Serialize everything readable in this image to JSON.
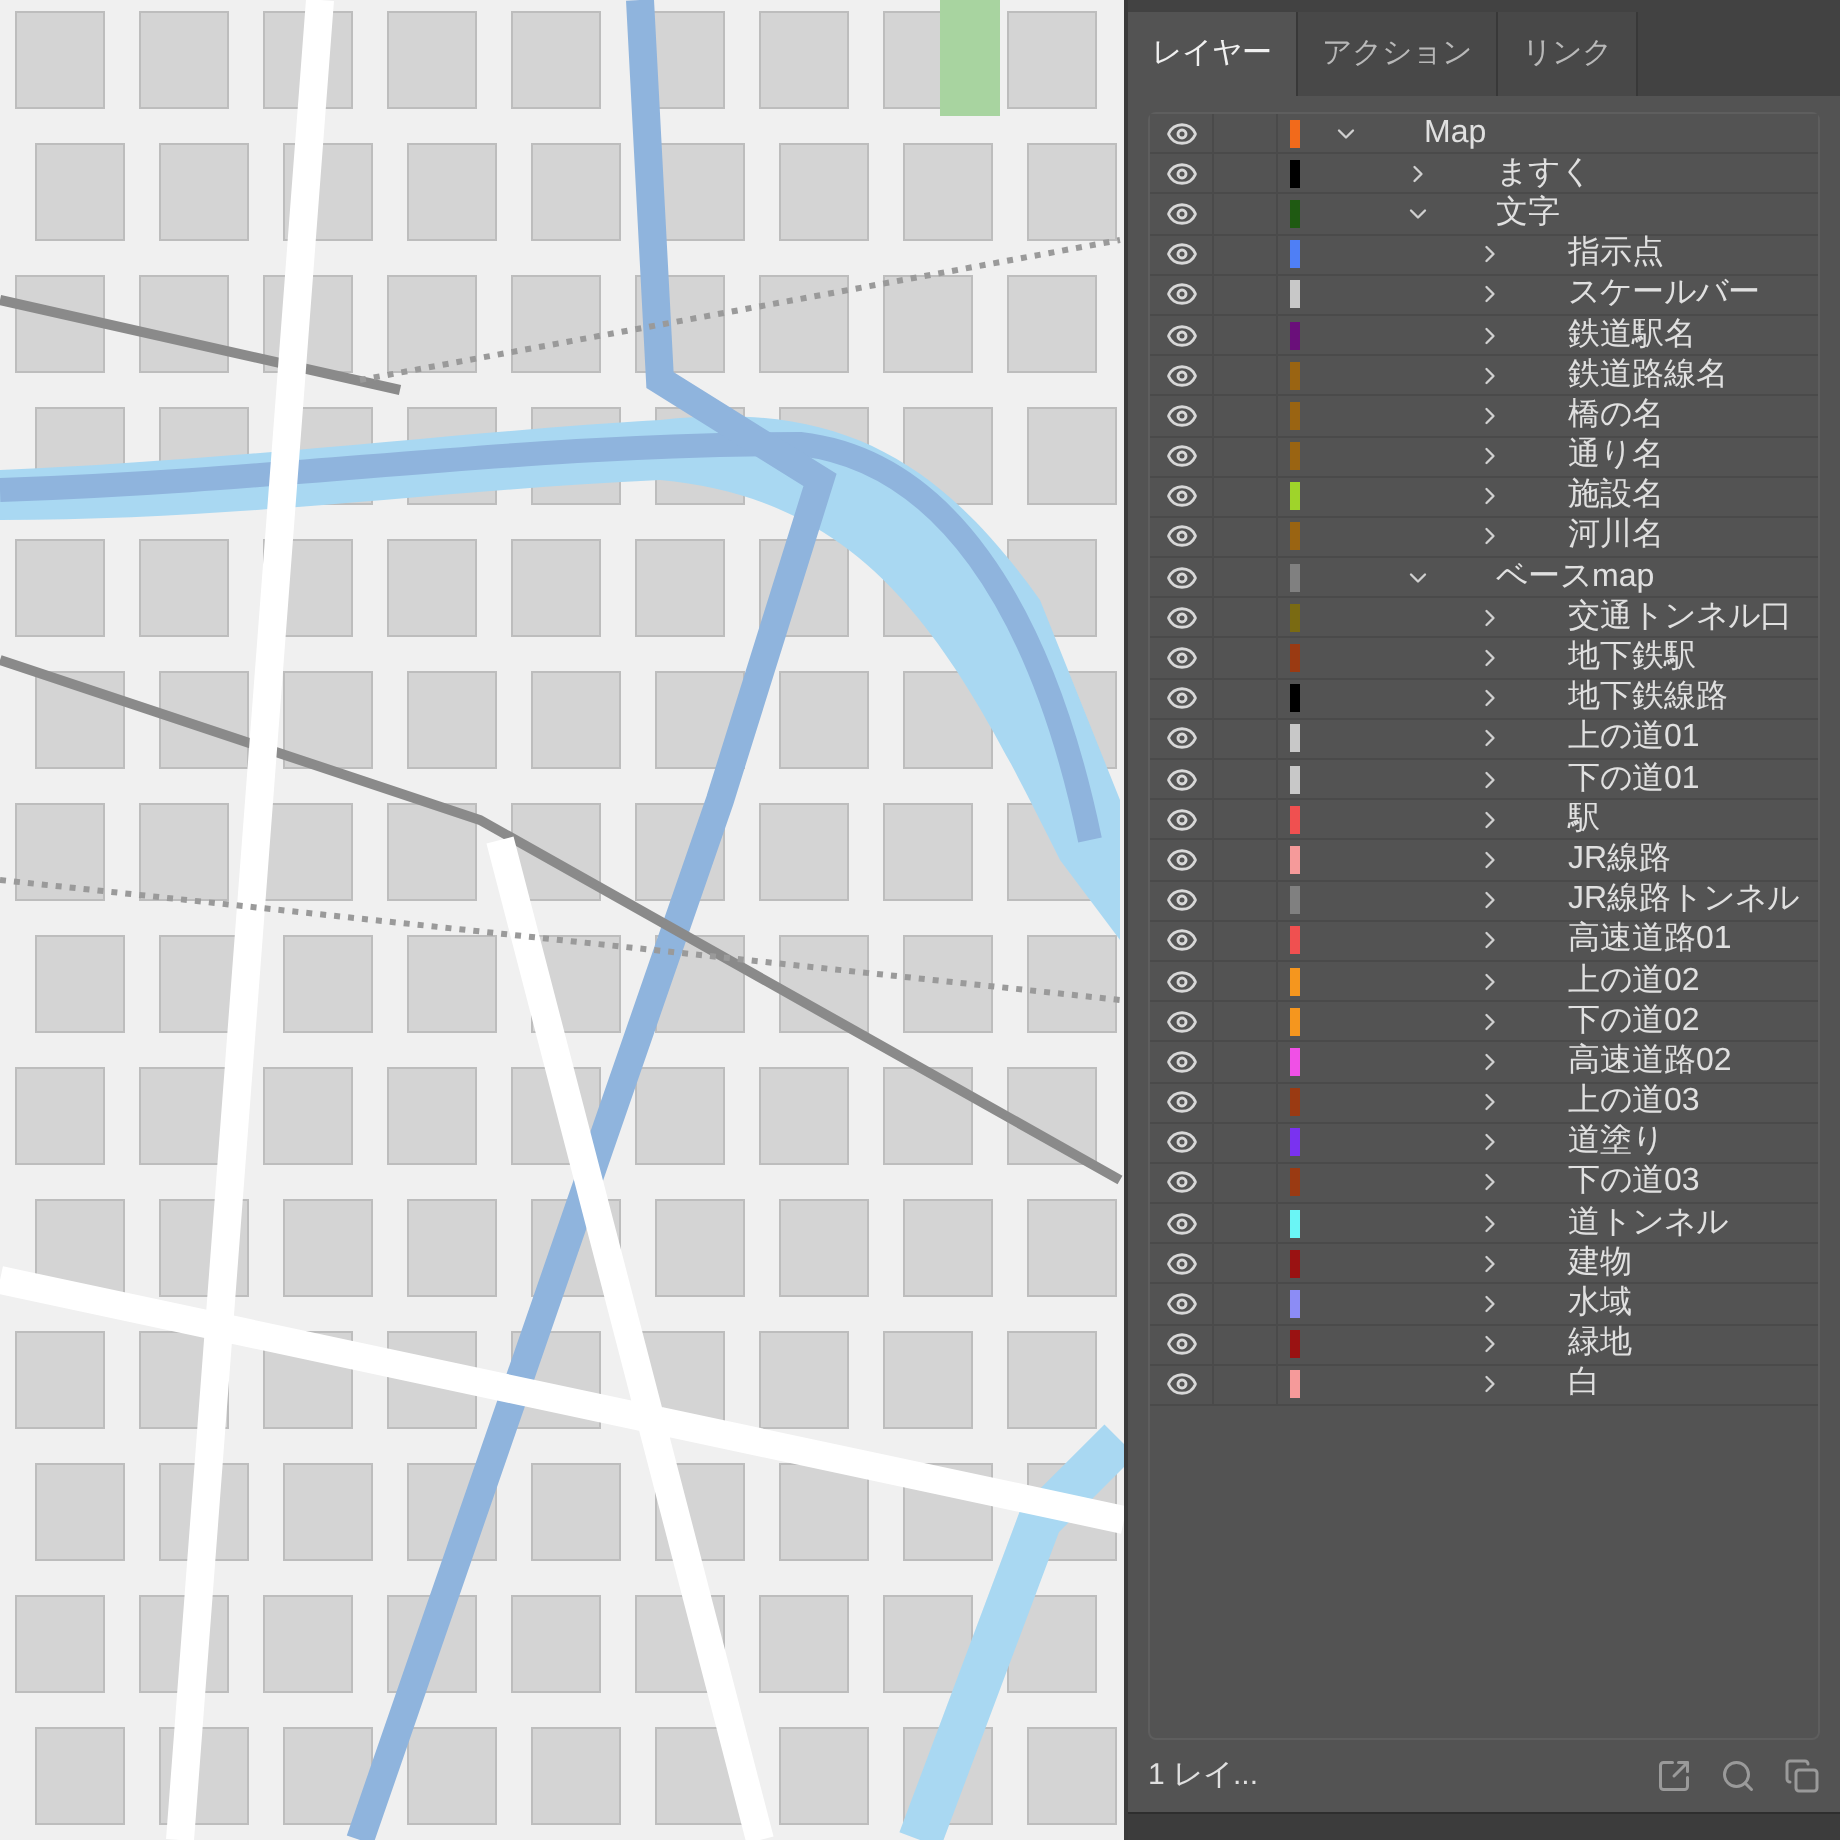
{
  "tabs": [
    {
      "label": "レイヤー",
      "selected": true
    },
    {
      "label": "アクション",
      "selected": false
    },
    {
      "label": "リンク",
      "selected": false
    }
  ],
  "layers": [
    {
      "name": "Map",
      "color": "#f26a1b",
      "visible": true,
      "expanded": true,
      "children": [
        {
          "name": "ますく",
          "color": "#000000",
          "visible": true,
          "expanded": false
        },
        {
          "name": "文字",
          "color": "#1f5a12",
          "visible": true,
          "expanded": true,
          "children": [
            {
              "name": "指示点",
              "color": "#4f7ff5",
              "visible": true,
              "expanded": false
            },
            {
              "name": "スケールバー",
              "color": "#c8c8c8",
              "visible": true,
              "expanded": false
            },
            {
              "name": "鉄道駅名",
              "color": "#6a0f7a",
              "visible": true,
              "expanded": false
            },
            {
              "name": "鉄道路線名",
              "color": "#9a6412",
              "visible": true,
              "expanded": false
            },
            {
              "name": "橋の名",
              "color": "#9a6412",
              "visible": true,
              "expanded": false
            },
            {
              "name": "通り名",
              "color": "#9a6412",
              "visible": true,
              "expanded": false
            },
            {
              "name": "施設名",
              "color": "#9fd42a",
              "visible": true,
              "expanded": false
            },
            {
              "name": "河川名",
              "color": "#9a6412",
              "visible": true,
              "expanded": false
            }
          ]
        },
        {
          "name": "ベースmap",
          "color": "#808080",
          "visible": true,
          "expanded": true,
          "children": [
            {
              "name": "交通トンネル口",
              "color": "#7a6a12",
              "visible": true,
              "expanded": false
            },
            {
              "name": "地下鉄駅",
              "color": "#9a3a12",
              "visible": true,
              "expanded": false
            },
            {
              "name": "地下鉄線路",
              "color": "#000000",
              "visible": true,
              "expanded": false
            },
            {
              "name": "上の道01",
              "color": "#c8c8c8",
              "visible": true,
              "expanded": false
            },
            {
              "name": "下の道01",
              "color": "#c8c8c8",
              "visible": true,
              "expanded": false
            },
            {
              "name": "駅",
              "color": "#f05050",
              "visible": true,
              "expanded": false
            },
            {
              "name": "JR線路",
              "color": "#f59a9a",
              "visible": true,
              "expanded": false
            },
            {
              "name": "JR線路トンネル",
              "color": "#808080",
              "visible": true,
              "expanded": false
            },
            {
              "name": "高速道路01",
              "color": "#f05050",
              "visible": true,
              "expanded": false
            },
            {
              "name": "上の道02",
              "color": "#f5961e",
              "visible": true,
              "expanded": false
            },
            {
              "name": "下の道02",
              "color": "#f5961e",
              "visible": true,
              "expanded": false
            },
            {
              "name": "高速道路02",
              "color": "#f050e6",
              "visible": true,
              "expanded": false
            },
            {
              "name": "上の道03",
              "color": "#9a3a12",
              "visible": true,
              "expanded": false
            },
            {
              "name": "道塗り",
              "color": "#7a32f0",
              "visible": true,
              "expanded": false
            },
            {
              "name": "下の道03",
              "color": "#9a3a12",
              "visible": true,
              "expanded": false
            },
            {
              "name": "道トンネル",
              "color": "#6af5f5",
              "visible": true,
              "expanded": false
            },
            {
              "name": "建物",
              "color": "#9a1212",
              "visible": true,
              "expanded": false
            },
            {
              "name": "水域",
              "color": "#8c8cf5",
              "visible": true,
              "expanded": false
            },
            {
              "name": "緑地",
              "color": "#9a1212",
              "visible": true,
              "expanded": false
            },
            {
              "name": "白",
              "color": "#f59a9a",
              "visible": true,
              "expanded": false
            }
          ]
        }
      ]
    }
  ],
  "footer": {
    "layer_count": "1 レイ..."
  }
}
